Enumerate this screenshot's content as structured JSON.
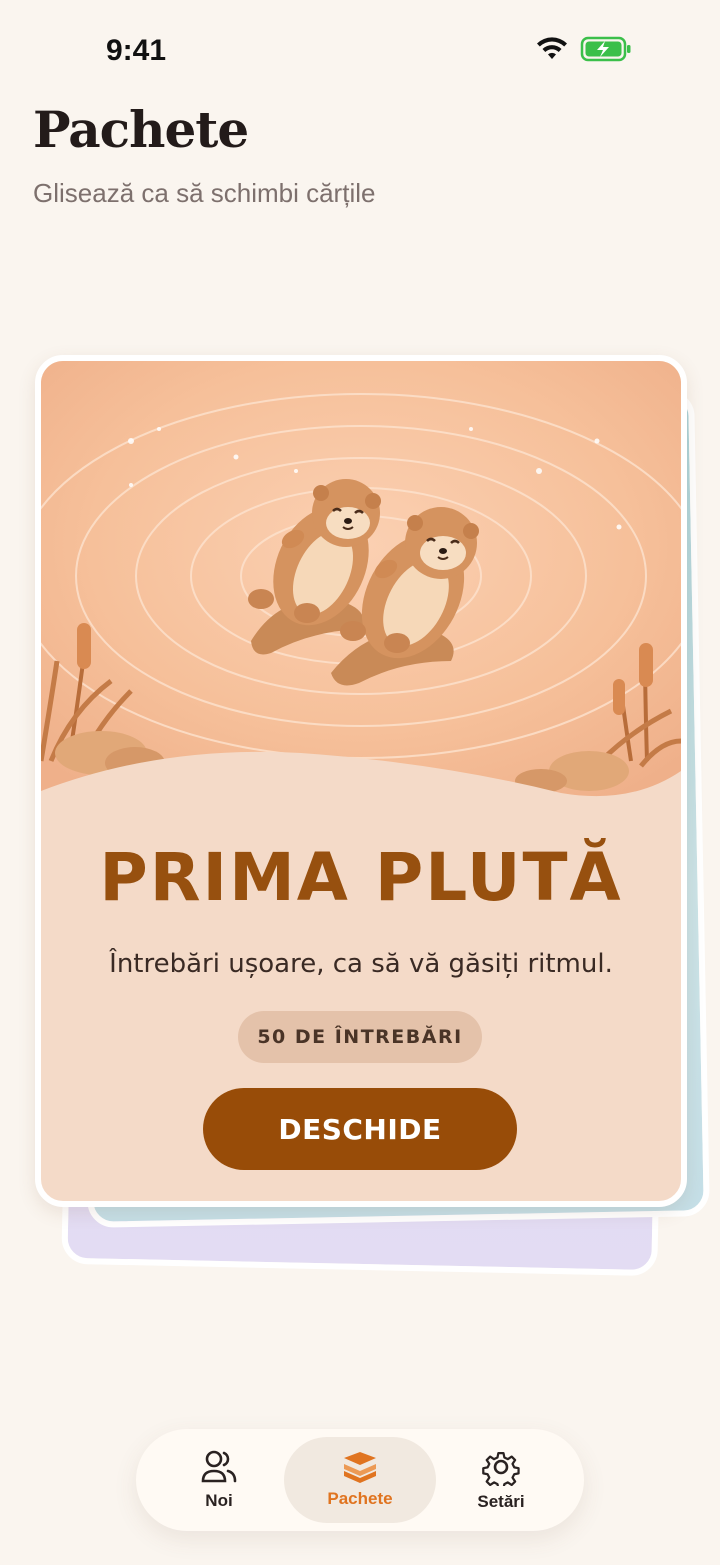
{
  "status_bar": {
    "time": "9:41",
    "icons": [
      "wifi-icon",
      "battery-charging-icon"
    ],
    "battery_color": "#3bbf4a"
  },
  "header": {
    "title": "Pachete",
    "subtitle": "Glisează ca să schimbi cărțile"
  },
  "deck": {
    "illustration": "two otters floating on water with reeds",
    "title": "PRIMA PLUTĂ",
    "description": "Întrebări ușoare, ca să vă găsiți ritmul.",
    "badge": "50 DE ÎNTREBĂRI",
    "button_label": "DESCHIDE",
    "colors": {
      "accent": "#984c08",
      "card_bg": "#f4dac8",
      "back_card_teal": "#a9d2d8",
      "back_card_lavender": "#d9d3ef"
    }
  },
  "bottom_nav": {
    "items": [
      {
        "label": "Noi",
        "icon": "people-icon",
        "active": false
      },
      {
        "label": "Pachete",
        "icon": "layers-icon",
        "active": true
      },
      {
        "label": "Setări",
        "icon": "gear-icon",
        "active": false
      }
    ],
    "active_color": "#e07420"
  }
}
